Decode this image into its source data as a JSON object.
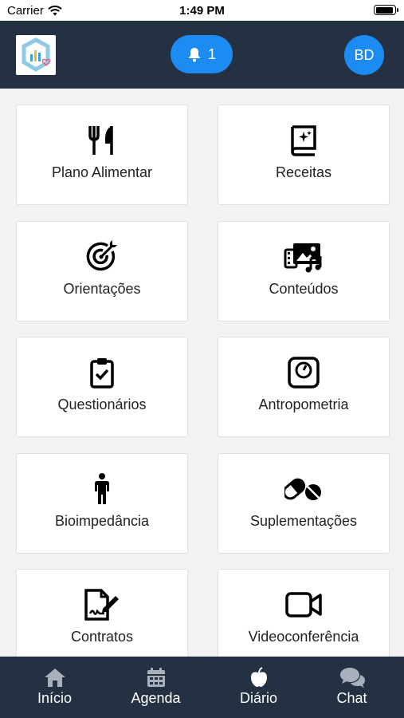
{
  "status_bar": {
    "carrier": "Carrier",
    "time": "1:49 PM"
  },
  "header": {
    "notification_count": "1",
    "avatar_initials": "BD"
  },
  "menu": [
    {
      "label": "Plano Alimentar",
      "icon": "utensils-icon"
    },
    {
      "label": "Receitas",
      "icon": "recipe-book-icon"
    },
    {
      "label": "Orientações",
      "icon": "target-icon"
    },
    {
      "label": "Conteúdos",
      "icon": "media-icon"
    },
    {
      "label": "Questionários",
      "icon": "clipboard-check-icon"
    },
    {
      "label": "Antropometria",
      "icon": "scale-icon"
    },
    {
      "label": "Bioimpedância",
      "icon": "person-icon"
    },
    {
      "label": "Suplementações",
      "icon": "pills-icon"
    },
    {
      "label": "Contratos",
      "icon": "contract-icon"
    },
    {
      "label": "Videoconferência",
      "icon": "video-camera-icon"
    }
  ],
  "tabs": [
    {
      "label": "Início",
      "icon": "home-icon"
    },
    {
      "label": "Agenda",
      "icon": "calendar-icon"
    },
    {
      "label": "Diário",
      "icon": "apple-icon"
    },
    {
      "label": "Chat",
      "icon": "chat-icon"
    }
  ],
  "colors": {
    "header_bg": "#243142",
    "accent": "#1d8cf2",
    "page_bg": "#f2f2f2"
  }
}
